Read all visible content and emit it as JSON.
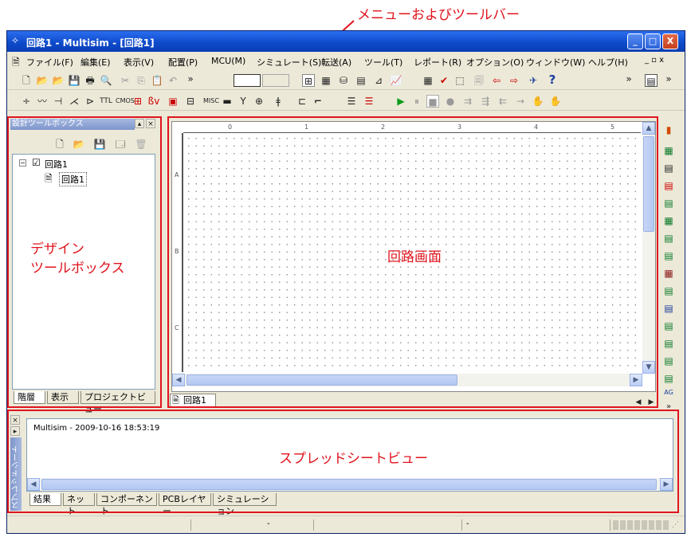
{
  "annotation": {
    "menu_label": "メニューおよびツールバー",
    "design_toolbox_line1": "デザイン",
    "design_toolbox_line2": "ツールボックス",
    "circuit_label": "回路画面",
    "spreadsheet_label": "スプレッドシートビュー",
    "color": "#e0141e"
  },
  "window": {
    "title": "回路1 - Multisim - [回路1]",
    "min": "_",
    "max": "□",
    "close": "X"
  },
  "menu": {
    "items": [
      "ファイル(F)",
      "編集(E)",
      "表示(V)",
      "配置(P)",
      "MCU(M)",
      "シミュレート(S)",
      "転送(A)",
      "ツール(T)",
      "レポート(R)",
      "オプション(O)",
      "ウィンドウ(W)",
      "ヘルプ(H)"
    ],
    "doc_controls": "_ ▫ x"
  },
  "design_toolbox": {
    "title": "設計ツールボックス",
    "tree_root": "回路1",
    "tree_child": "回路1",
    "tabs": [
      "階層",
      "表示",
      "プロジェクトビュー"
    ]
  },
  "circuit": {
    "ruler_top": [
      "0",
      "1",
      "2",
      "3",
      "4",
      "5"
    ],
    "ruler_left": [
      "A",
      "B",
      "C"
    ],
    "tab": "回路1"
  },
  "spreadsheet": {
    "side_title": "スプレッドシート",
    "log_line": "Multisim  -  2009-10-16 18:53:19",
    "tabs": [
      "結果",
      "ネット",
      "コンポーネント",
      "PCBレイヤー",
      "シミュレーション"
    ]
  },
  "status": {
    "cell1": "-",
    "cell2": "-"
  },
  "icons": [
    "new-icon",
    "open-icon",
    "save-icon",
    "print-icon",
    "preview-icon",
    "cut-icon",
    "copy-icon",
    "paste-icon",
    "undo-icon",
    "run-icon",
    "pause-icon",
    "stop-icon",
    "help-icon"
  ]
}
